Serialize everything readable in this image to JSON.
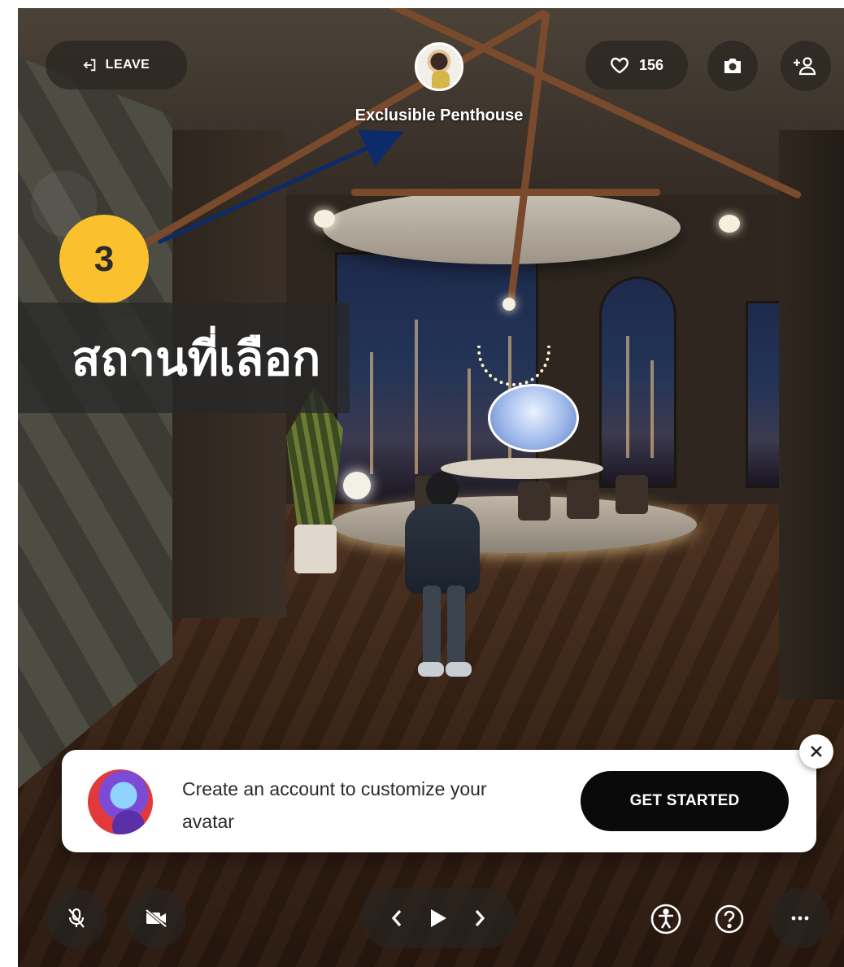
{
  "header": {
    "leave_label": "LEAVE",
    "space_title": "Exclusible Penthouse",
    "likes_count": "156"
  },
  "annotation": {
    "step_number": "3",
    "callout_text": "สถานที่เลือก",
    "badge_color": "#fbc02d",
    "arrow_color": "#0d2a6b"
  },
  "toast": {
    "message": "Create an account to customize your avatar",
    "cta_label": "GET STARTED"
  },
  "icons": {
    "leave": "leave-icon",
    "like": "heart-icon",
    "camera": "camera-icon",
    "invite": "add-person-icon",
    "mic": "mic-muted-icon",
    "video": "video-off-icon",
    "prev": "chevron-left-icon",
    "play": "play-icon",
    "next": "chevron-right-icon",
    "accessibility": "accessibility-icon",
    "help": "help-icon",
    "more": "more-icon",
    "close": "close-icon"
  }
}
